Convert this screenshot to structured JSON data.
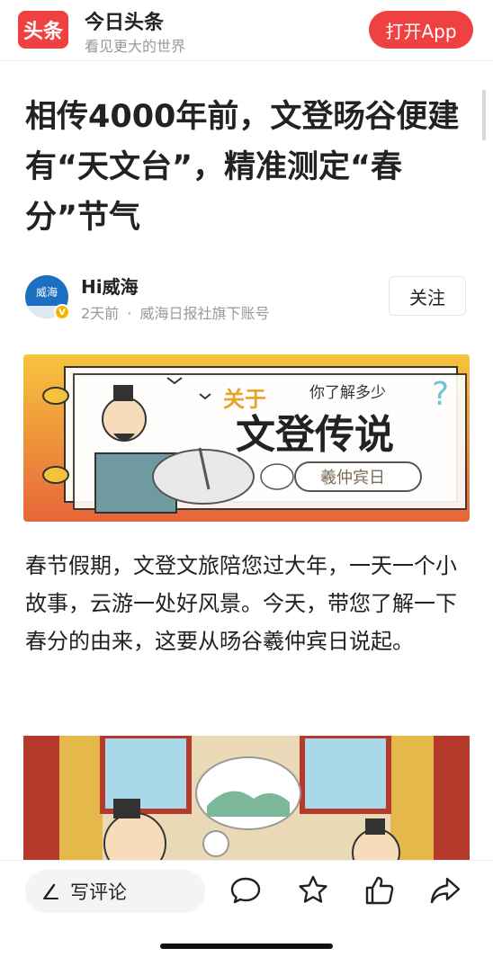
{
  "header": {
    "logo_text": "头条",
    "app_name": "今日头条",
    "slogan": "看见更大的世界",
    "open_app_label": "打开App"
  },
  "article": {
    "title": "相传4000年前，文登旸谷便建有“天文台”，精准测定“春分”节气",
    "author": {
      "name": "Hi威海",
      "avatar_text": "威海",
      "time": "2天前",
      "separator": "·",
      "source": "威海日报社旗下账号",
      "follow_label": "关注"
    },
    "banner": {
      "kicker": "关于",
      "question": "你了解多少",
      "headline": "文登传说",
      "tag": "羲仲宾日"
    },
    "paragraph": "春节假期，文登文旅陪您过大年，一天一个小故事，云游一处好风景。今天，带您了解一下春分的由来，这要从旸谷羲仲宾日说起。"
  },
  "bottombar": {
    "comment_label": "写评论",
    "icons": [
      "comment-icon",
      "star-icon",
      "like-icon",
      "share-icon"
    ]
  },
  "colors": {
    "brand_red": "#f04142",
    "banner_orange": "#e8703a",
    "banner_yellow": "#f5c33b",
    "text_gray": "#999999"
  }
}
